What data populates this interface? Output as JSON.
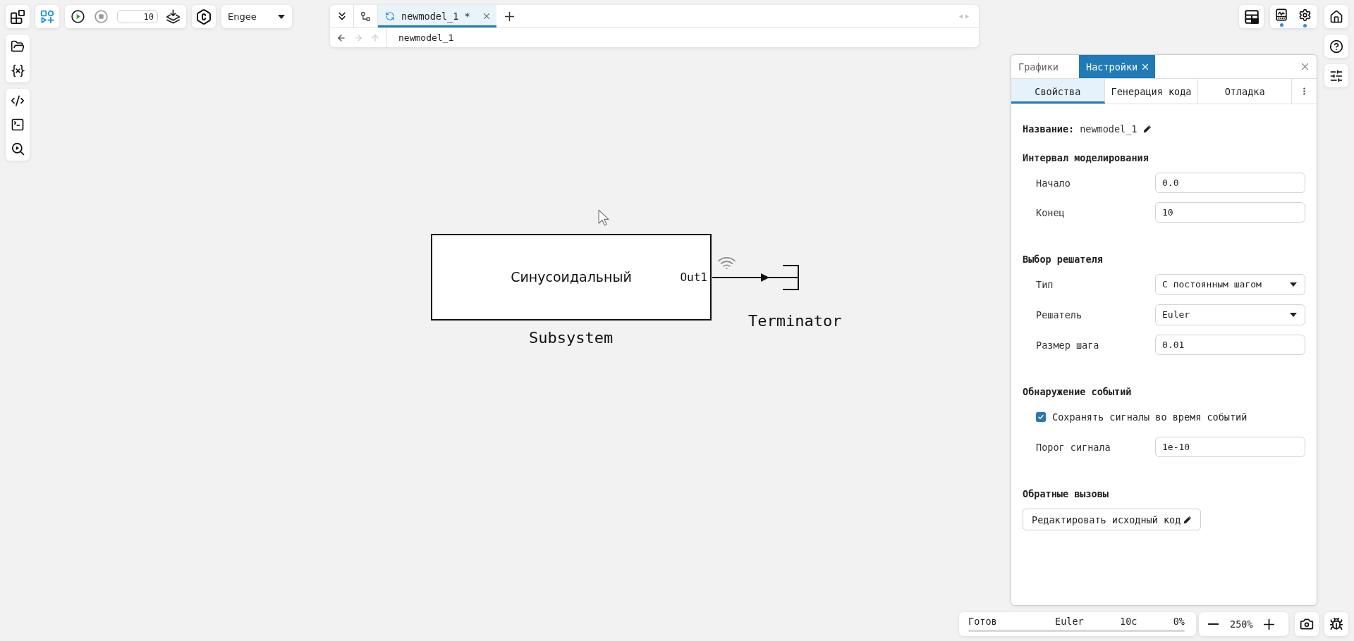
{
  "toolbar": {
    "stop_time": "10",
    "environment": "Engee"
  },
  "editor": {
    "tabs": [
      {
        "label": "newmodel_1 *",
        "selected": true
      }
    ],
    "navigation": [
      {
        "kind": "back",
        "disabled": false
      },
      {
        "kind": "forward",
        "disabled": true
      },
      {
        "kind": "up",
        "disabled": true
      }
    ],
    "path": "newmodel_1"
  },
  "canvas": {
    "blocks": [
      {
        "kind": "subsystem",
        "title": "Синусоидальный",
        "port": "Out1",
        "name": "Subsystem"
      },
      {
        "kind": "terminator",
        "name": "Terminator"
      }
    ]
  },
  "panel": {
    "tabs": [
      {
        "label": "Графики",
        "selected": false,
        "closable": false
      },
      {
        "label": "Настройки",
        "selected": true,
        "closable": true
      }
    ],
    "subtabs": [
      {
        "label": "Свойства",
        "selected": true
      },
      {
        "label": "Генерация кода",
        "selected": false
      },
      {
        "label": "Отладка",
        "selected": false
      }
    ],
    "name": {
      "label": "Название:",
      "value": "newmodel_1"
    },
    "sections": [
      {
        "title": "Интервал моделирования",
        "rows": [
          {
            "kind": "input",
            "label": "Начало",
            "value": "0.0"
          },
          {
            "kind": "input",
            "label": "Конец",
            "value": "10"
          }
        ]
      },
      {
        "title": "Выбор решателя",
        "rows": [
          {
            "kind": "select",
            "label": "Тип",
            "value": "С постоянным шагом"
          },
          {
            "kind": "select",
            "label": "Решатель",
            "value": "Euler"
          },
          {
            "kind": "input",
            "label": "Размер шага",
            "value": "0.01"
          }
        ]
      },
      {
        "title": "Обнаружение событий",
        "rows": [
          {
            "kind": "checkbox",
            "label": "Сохранять сигналы во время событий",
            "checked": true
          },
          {
            "kind": "input",
            "label": "Порог сигнала",
            "value": "1e-10"
          }
        ]
      },
      {
        "title": "Обратные вызовы",
        "rows": [
          {
            "kind": "button",
            "label": "Редактировать исходный код"
          }
        ]
      }
    ]
  },
  "status_bar": {
    "state": "Готов",
    "solver": "Euler",
    "time": "10с",
    "progress": "0%"
  },
  "zoom": {
    "value": "250%"
  }
}
